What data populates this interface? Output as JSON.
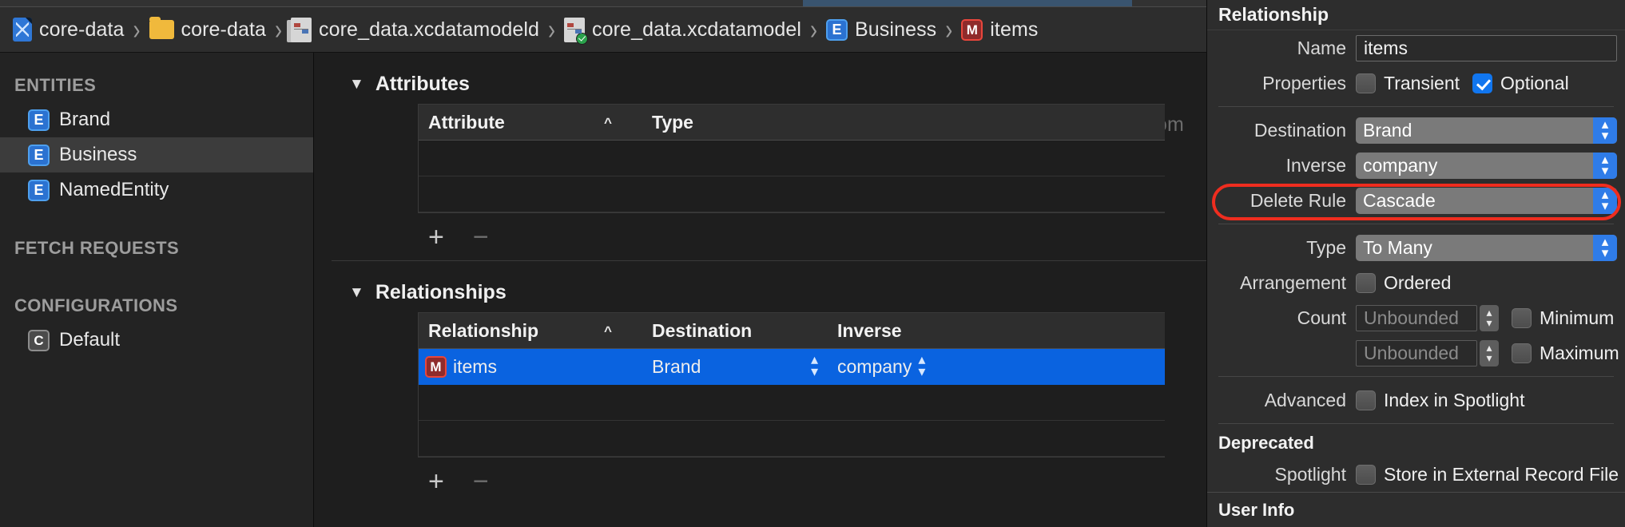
{
  "breadcrumb": [
    {
      "icon": "swift-project-icon",
      "label": "core-data"
    },
    {
      "icon": "folder-icon",
      "label": "core-data"
    },
    {
      "icon": "xcdatamodeld-icon",
      "label": "core_data.xcdatamodeld"
    },
    {
      "icon": "xcdatamodel-icon",
      "label": "core_data.xcdatamodel"
    },
    {
      "icon": "entity-icon",
      "label": "Business"
    },
    {
      "icon": "relationship-icon",
      "label": "items"
    }
  ],
  "sidebar": {
    "groups": [
      {
        "header": "ENTITIES",
        "items": [
          {
            "icon": "E",
            "label": "Brand",
            "selected": false
          },
          {
            "icon": "E",
            "label": "Business",
            "selected": true
          },
          {
            "icon": "E",
            "label": "NamedEntity",
            "selected": false
          }
        ]
      },
      {
        "header": "FETCH REQUESTS",
        "items": []
      },
      {
        "header": "CONFIGURATIONS",
        "items": [
          {
            "icon": "C",
            "label": "Default",
            "selected": false
          }
        ]
      }
    ]
  },
  "editor": {
    "watermark": "advancedswift.com",
    "attributes": {
      "title": "Attributes",
      "columns": [
        "Attribute",
        "Type"
      ],
      "sort_indicator": "^",
      "rows": [],
      "add_label": "+",
      "remove_label": "−"
    },
    "relationships": {
      "title": "Relationships",
      "columns": [
        "Relationship",
        "Destination",
        "Inverse"
      ],
      "sort_indicator": "^",
      "rows": [
        {
          "icon": "M",
          "relationship": "items",
          "destination": "Brand",
          "inverse": "company",
          "selected": true
        }
      ],
      "add_label": "+",
      "remove_label": "−"
    }
  },
  "inspector": {
    "title": "Relationship",
    "name": {
      "label": "Name",
      "value": "items"
    },
    "properties": {
      "label": "Properties",
      "transient": {
        "label": "Transient",
        "checked": false
      },
      "optional": {
        "label": "Optional",
        "checked": true
      }
    },
    "destination": {
      "label": "Destination",
      "value": "Brand"
    },
    "inverse": {
      "label": "Inverse",
      "value": "company"
    },
    "delete_rule": {
      "label": "Delete Rule",
      "value": "Cascade",
      "highlighted": true
    },
    "type": {
      "label": "Type",
      "value": "To Many"
    },
    "arrangement": {
      "label": "Arrangement",
      "ordered": {
        "label": "Ordered",
        "checked": false
      }
    },
    "count": {
      "label": "Count",
      "min_placeholder": "Unbounded",
      "min_checkbox": {
        "label": "Minimum",
        "checked": false
      },
      "max_placeholder": "Unbounded",
      "max_checkbox": {
        "label": "Maximum",
        "checked": false
      }
    },
    "advanced": {
      "label": "Advanced",
      "index_in_spotlight": {
        "label": "Index in Spotlight",
        "checked": false
      }
    },
    "deprecated": {
      "heading": "Deprecated",
      "label": "Spotlight",
      "store_external": {
        "label": "Store in External Record File",
        "checked": false
      }
    },
    "user_info": {
      "heading": "User Info"
    },
    "highlight_color": "#ef2d1f"
  }
}
